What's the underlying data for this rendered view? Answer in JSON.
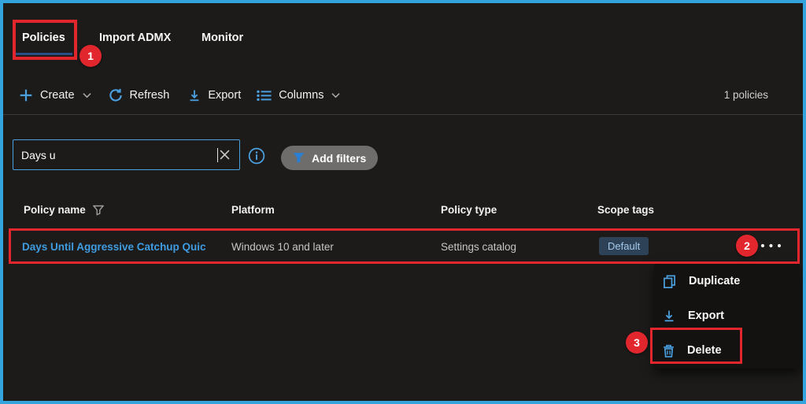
{
  "tabs": [
    {
      "label": "Policies",
      "active": true
    },
    {
      "label": "Import ADMX",
      "active": false
    },
    {
      "label": "Monitor",
      "active": false
    }
  ],
  "toolbar": {
    "create": "Create",
    "refresh": "Refresh",
    "export": "Export",
    "columns": "Columns",
    "count": "1 policies"
  },
  "search": {
    "value": "Days u"
  },
  "filters": {
    "add_filters": "Add filters"
  },
  "table": {
    "headers": {
      "policy_name": "Policy name",
      "platform": "Platform",
      "policy_type": "Policy type",
      "scope_tags": "Scope tags"
    },
    "row": {
      "policy_name": "Days Until Aggressive Catchup Quic",
      "platform": "Windows 10 and later",
      "policy_type": "Settings catalog",
      "scope_tag": "Default"
    }
  },
  "context_menu": {
    "items": [
      {
        "label": "Duplicate",
        "icon": "copy-icon"
      },
      {
        "label": "Export",
        "icon": "download-icon"
      },
      {
        "label": "Delete",
        "icon": "trash-icon"
      }
    ]
  },
  "annotations": {
    "step1": "1",
    "step2": "2",
    "step3": "3"
  },
  "colors": {
    "accent_blue": "#4ba0e0",
    "link_blue": "#3f9ce0",
    "annotation_red": "#e2262d",
    "frame_border": "#35a3dc",
    "scope_badge_bg": "#2e4257",
    "scope_badge_text": "#a4c9ec"
  }
}
